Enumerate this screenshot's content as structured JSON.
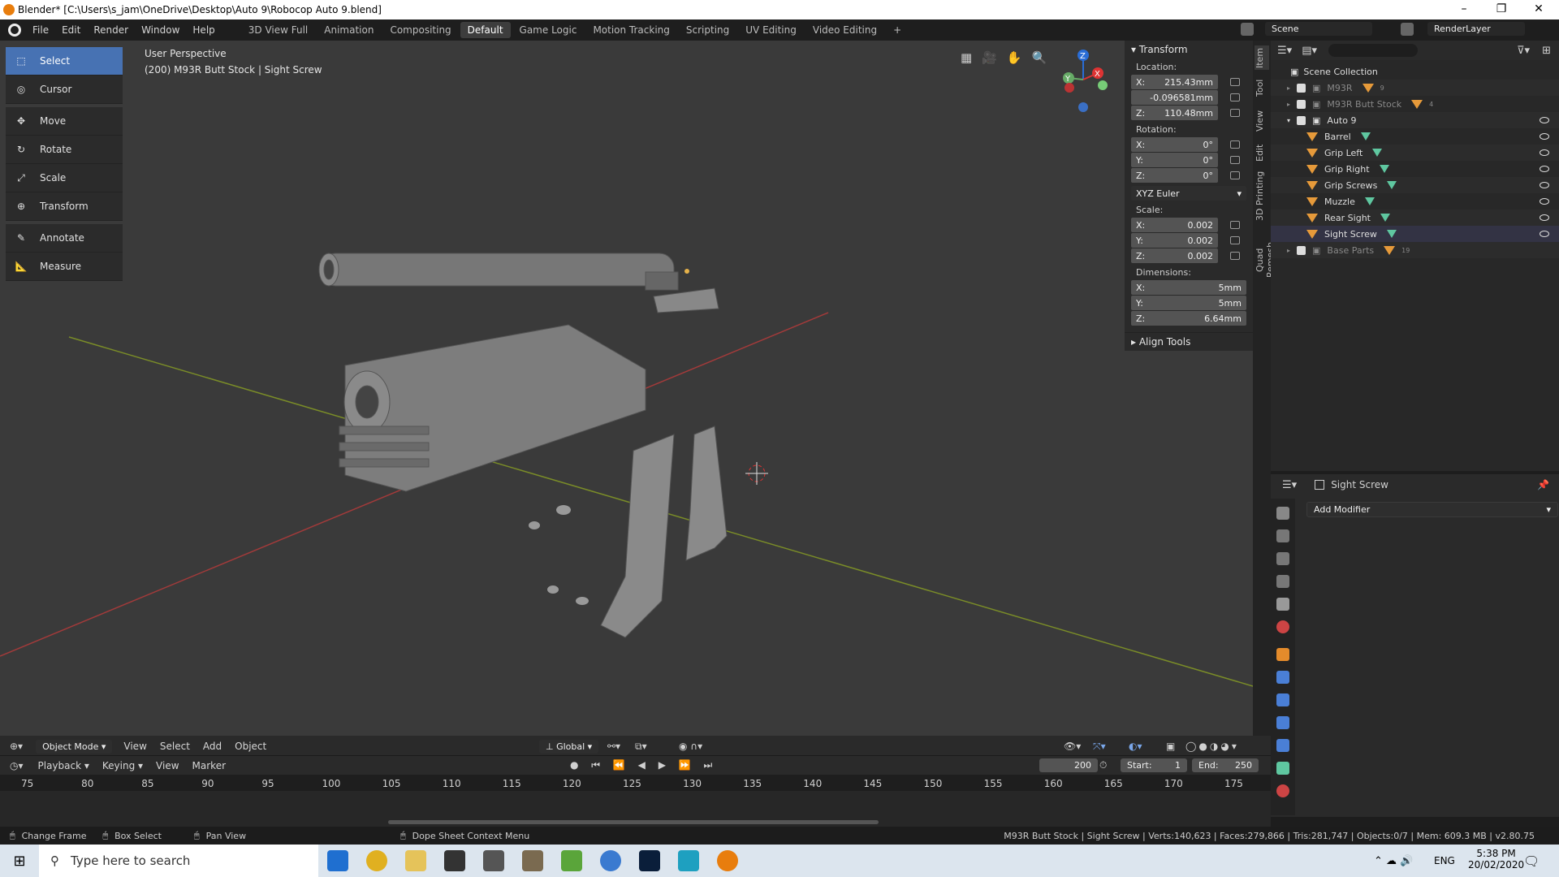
{
  "window": {
    "title": "Blender* [C:\\Users\\s_jam\\OneDrive\\Desktop\\Auto 9\\Robocop Auto 9.blend]",
    "minimize": "–",
    "maximize": "❐",
    "close": "✕"
  },
  "topbar": {
    "menus": [
      "File",
      "Edit",
      "Render",
      "Window",
      "Help"
    ],
    "workspaces": [
      "3D View Full",
      "Animation",
      "Compositing",
      "Default",
      "Game Logic",
      "Motion Tracking",
      "Scripting",
      "UV Editing",
      "Video Editing"
    ],
    "active_workspace": "Default",
    "add_tab": "+",
    "scene_name": "Scene",
    "view_layer": "RenderLayer"
  },
  "viewport": {
    "perspective": "User Perspective",
    "object_info": "(200) M93R Butt Stock | Sight Screw",
    "tools": [
      {
        "label": "Select",
        "icon": "select-box-icon",
        "active": true
      },
      {
        "label": "Cursor",
        "icon": "cursor-icon"
      },
      {
        "label": "Move",
        "icon": "move-icon"
      },
      {
        "label": "Rotate",
        "icon": "rotate-icon"
      },
      {
        "label": "Scale",
        "icon": "scale-icon"
      },
      {
        "label": "Transform",
        "icon": "transform-icon"
      },
      {
        "label": "Annotate",
        "icon": "annotate-icon"
      },
      {
        "label": "Measure",
        "icon": "measure-icon"
      }
    ],
    "gizmo": {
      "x": "X",
      "y": "Y",
      "z": "Z"
    }
  },
  "transform_panel": {
    "header": "Transform",
    "location_label": "Location:",
    "location": [
      {
        "axis": "X:",
        "value": "215.43mm"
      },
      {
        "axis": "",
        "value": "-0.096581mm"
      },
      {
        "axis": "Z:",
        "value": "110.48mm"
      }
    ],
    "rotation_label": "Rotation:",
    "rotation": [
      {
        "axis": "X:",
        "value": "0°"
      },
      {
        "axis": "Y:",
        "value": "0°"
      },
      {
        "axis": "Z:",
        "value": "0°"
      }
    ],
    "rotation_mode": "XYZ Euler",
    "scale_label": "Scale:",
    "scale": [
      {
        "axis": "X:",
        "value": "0.002"
      },
      {
        "axis": "Y:",
        "value": "0.002"
      },
      {
        "axis": "Z:",
        "value": "0.002"
      }
    ],
    "dimensions_label": "Dimensions:",
    "dimensions": [
      {
        "axis": "X:",
        "value": "5mm"
      },
      {
        "axis": "Y:",
        "value": "5mm"
      },
      {
        "axis": "Z:",
        "value": "6.64mm"
      }
    ],
    "align_tools": "Align Tools"
  },
  "side_tabs": [
    "Item",
    "Tool",
    "View",
    "Edit",
    "3D Printing",
    "Quad Remesh"
  ],
  "outliner": {
    "root": "Scene Collection",
    "rows": [
      {
        "name": "M93R",
        "badge": "9",
        "dim": true
      },
      {
        "name": "M93R Butt Stock",
        "badge": "4",
        "dim": true
      },
      {
        "name": "Auto 9",
        "dim": false
      },
      {
        "name": "Barrel"
      },
      {
        "name": "Grip Left"
      },
      {
        "name": "Grip Right"
      },
      {
        "name": "Grip Screws"
      },
      {
        "name": "Muzzle"
      },
      {
        "name": "Rear Sight"
      },
      {
        "name": "Sight Screw"
      },
      {
        "name": "Base Parts",
        "badge": "19",
        "dim": true
      }
    ]
  },
  "properties": {
    "object_name": "Sight Screw",
    "add_modifier": "Add Modifier"
  },
  "viewport_header": {
    "mode": "Object Mode",
    "menus": [
      "View",
      "Select",
      "Add",
      "Object"
    ],
    "orientation": "Global"
  },
  "timeline": {
    "menus": [
      "Playback",
      "Keying",
      "View",
      "Marker"
    ],
    "current_frame": "200",
    "start_label": "Start:",
    "start": "1",
    "end_label": "End:",
    "end": "250",
    "ruler": [
      "75",
      "80",
      "85",
      "90",
      "95",
      "100",
      "105",
      "110",
      "115",
      "120",
      "125",
      "130",
      "135",
      "140",
      "145",
      "150",
      "155",
      "160",
      "165",
      "170",
      "175"
    ]
  },
  "statusbar": {
    "left": [
      "Change Frame",
      "Box Select",
      "Pan View",
      "Dope Sheet Context Menu"
    ],
    "stats": "M93R Butt Stock | Sight Screw | Verts:140,623 | Faces:279,866 | Tris:281,747 | Objects:0/7 | Mem: 609.3 MB | v2.80.75"
  },
  "taskbar": {
    "search_placeholder": "Type here to search",
    "lang": "ENG",
    "time": "5:38 PM",
    "date": "20/02/2020"
  }
}
